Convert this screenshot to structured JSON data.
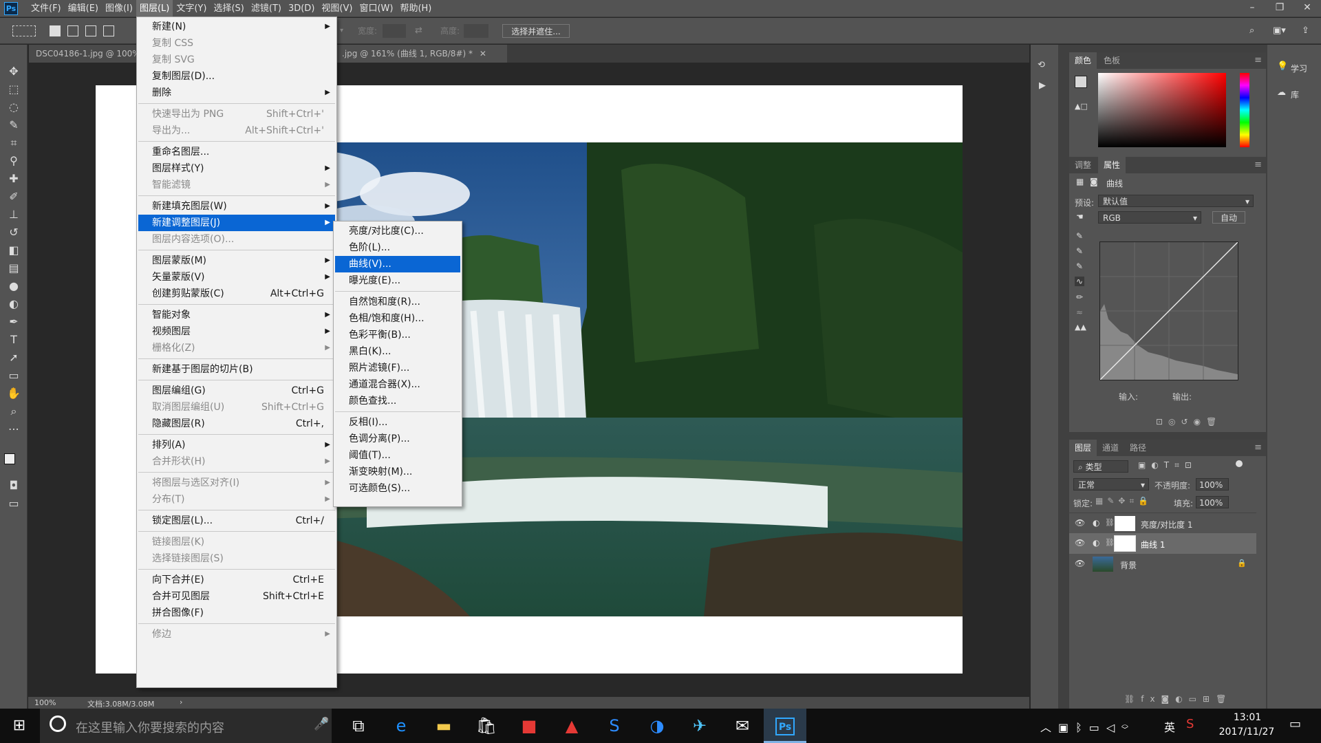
{
  "app": {
    "logo": "Ps",
    "menus": [
      "文件(F)",
      "编辑(E)",
      "图像(I)",
      "图层(L)",
      "文字(Y)",
      "选择(S)",
      "滤镜(T)",
      "3D(D)",
      "视图(V)",
      "窗口(W)",
      "帮助(H)"
    ],
    "active_menu": "图层(L)",
    "window_controls": [
      "minimize-icon",
      "restore-icon",
      "close-icon"
    ]
  },
  "options": {
    "width_label": "宽度:",
    "height_label": "高度:",
    "select_mask_button": "选择并遮住..."
  },
  "tabs": [
    {
      "label": "DSC04186-1.jpg @ 100%"
    },
    {
      "label": ".jpg @ 161% (曲线 1, RGB/8#) *"
    }
  ],
  "status": {
    "zoom": "100%",
    "doc": "文档:3.08M/3.08M"
  },
  "layer_menu": [
    {
      "label": "新建(N)",
      "arrow": true
    },
    {
      "label": "复制 CSS",
      "disabled": true
    },
    {
      "label": "复制 SVG",
      "disabled": true
    },
    {
      "label": "复制图层(D)..."
    },
    {
      "label": "删除",
      "arrow": true
    },
    {
      "sep": true
    },
    {
      "label": "快速导出为 PNG",
      "shortcut": "Shift+Ctrl+'",
      "disabled": true
    },
    {
      "label": "导出为...",
      "shortcut": "Alt+Shift+Ctrl+'",
      "disabled": true
    },
    {
      "sep": true
    },
    {
      "label": "重命名图层..."
    },
    {
      "label": "图层样式(Y)",
      "arrow": true
    },
    {
      "label": "智能滤镜",
      "arrow": true,
      "disabled": true
    },
    {
      "sep": true
    },
    {
      "label": "新建填充图层(W)",
      "arrow": true
    },
    {
      "label": "新建调整图层(J)",
      "arrow": true,
      "highlight": true
    },
    {
      "label": "图层内容选项(O)...",
      "disabled": true
    },
    {
      "sep": true
    },
    {
      "label": "图层蒙版(M)",
      "arrow": true
    },
    {
      "label": "矢量蒙版(V)",
      "arrow": true
    },
    {
      "label": "创建剪贴蒙版(C)",
      "shortcut": "Alt+Ctrl+G"
    },
    {
      "sep": true
    },
    {
      "label": "智能对象",
      "arrow": true
    },
    {
      "label": "视频图层",
      "arrow": true
    },
    {
      "label": "栅格化(Z)",
      "arrow": true,
      "disabled": true
    },
    {
      "sep": true
    },
    {
      "label": "新建基于图层的切片(B)"
    },
    {
      "sep": true
    },
    {
      "label": "图层编组(G)",
      "shortcut": "Ctrl+G"
    },
    {
      "label": "取消图层编组(U)",
      "shortcut": "Shift+Ctrl+G",
      "disabled": true
    },
    {
      "label": "隐藏图层(R)",
      "shortcut": "Ctrl+,"
    },
    {
      "sep": true
    },
    {
      "label": "排列(A)",
      "arrow": true
    },
    {
      "label": "合并形状(H)",
      "arrow": true,
      "disabled": true
    },
    {
      "sep": true
    },
    {
      "label": "将图层与选区对齐(I)",
      "arrow": true,
      "disabled": true
    },
    {
      "label": "分布(T)",
      "arrow": true,
      "disabled": true
    },
    {
      "sep": true
    },
    {
      "label": "锁定图层(L)...",
      "shortcut": "Ctrl+/"
    },
    {
      "sep": true
    },
    {
      "label": "链接图层(K)",
      "disabled": true
    },
    {
      "label": "选择链接图层(S)",
      "disabled": true
    },
    {
      "sep": true
    },
    {
      "label": "向下合并(E)",
      "shortcut": "Ctrl+E"
    },
    {
      "label": "合并可见图层",
      "shortcut": "Shift+Ctrl+E"
    },
    {
      "label": "拼合图像(F)"
    },
    {
      "sep": true
    },
    {
      "label": "修边",
      "arrow": true,
      "disabled": true
    }
  ],
  "adjust_submenu": [
    {
      "label": "亮度/对比度(C)..."
    },
    {
      "label": "色阶(L)..."
    },
    {
      "label": "曲线(V)...",
      "highlight": true
    },
    {
      "label": "曝光度(E)..."
    },
    {
      "sep": true
    },
    {
      "label": "自然饱和度(R)..."
    },
    {
      "label": "色相/饱和度(H)..."
    },
    {
      "label": "色彩平衡(B)..."
    },
    {
      "label": "黑白(K)..."
    },
    {
      "label": "照片滤镜(F)..."
    },
    {
      "label": "通道混合器(X)..."
    },
    {
      "label": "颜色查找..."
    },
    {
      "sep": true
    },
    {
      "label": "反相(I)..."
    },
    {
      "label": "色调分离(P)..."
    },
    {
      "label": "阈值(T)..."
    },
    {
      "label": "渐变映射(M)..."
    },
    {
      "label": "可选颜色(S)..."
    }
  ],
  "dock_side": {
    "learn": "学习",
    "library": "库"
  },
  "color_panel": {
    "tabs": [
      "颜色",
      "色板"
    ]
  },
  "properties_panel": {
    "tabs": [
      "调整",
      "属性"
    ],
    "title": "曲线",
    "preset_label": "预设:",
    "preset_value": "默认值",
    "channel": "RGB",
    "auto_button": "自动",
    "input_label": "输入:",
    "output_label": "输出:"
  },
  "layers_panel": {
    "tabs": [
      "图层",
      "通道",
      "路径"
    ],
    "filter_kind": "类型",
    "blend_mode": "正常",
    "opacity_label": "不透明度:",
    "opacity_value": "100%",
    "lock_label": "锁定:",
    "fill_label": "填充:",
    "fill_value": "100%",
    "layers": [
      {
        "name": "亮度/对比度 1",
        "kind": "adjustment"
      },
      {
        "name": "曲线 1",
        "kind": "adjustment",
        "selected": true
      },
      {
        "name": "背景",
        "kind": "image",
        "locked": true
      }
    ]
  },
  "taskbar": {
    "search_placeholder": "在这里输入你要搜索的内容",
    "ime": "英",
    "time": "13:01",
    "date": "2017/11/27"
  },
  "colors": {
    "menu_highlight": "#0a66d4",
    "ps_blue": "#31a8ff",
    "panel_bg": "#535353"
  }
}
